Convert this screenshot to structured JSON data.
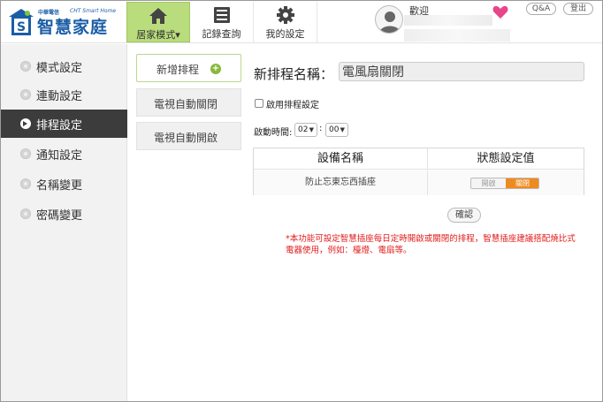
{
  "app": {
    "logo_title": "智慧家庭",
    "logo_company": "中華電信",
    "logo_english": "CHT Smart Home"
  },
  "topnav": {
    "items": [
      {
        "label": "居家模式▾",
        "icon": "home-icon",
        "active": true
      },
      {
        "label": "記錄查詢",
        "icon": "list-icon",
        "active": false
      },
      {
        "label": "我的設定",
        "icon": "gear-icon",
        "active": false
      }
    ]
  },
  "user": {
    "welcome": "歡迎"
  },
  "header_buttons": {
    "qa": "Q&A",
    "logout": "登出"
  },
  "sidebar": {
    "items": [
      {
        "label": "模式設定",
        "active": false
      },
      {
        "label": "連動設定",
        "active": false
      },
      {
        "label": "排程設定",
        "active": true
      },
      {
        "label": "通知設定",
        "active": false
      },
      {
        "label": "名稱變更",
        "active": false
      },
      {
        "label": "密碼變更",
        "active": false
      }
    ]
  },
  "schedules": {
    "new_label": "新增排程",
    "new_icon": "+",
    "items": [
      {
        "label": "電視自動關閉"
      },
      {
        "label": "電視自動開啟"
      }
    ]
  },
  "form": {
    "name_label": "新排程名稱：",
    "name_value": "電風扇關閉",
    "enable_label": "啟用排程設定",
    "enable_checked": false,
    "start_time_label": "啟動時間:",
    "hour": "02",
    "minute": "00",
    "colon": ":"
  },
  "device_table": {
    "col_device": "設備名稱",
    "col_state": "狀態設定值",
    "rows": [
      {
        "device": "防止忘東忘西插座",
        "off_label": "開啟",
        "on_label": "關閉",
        "selected": "關閉"
      }
    ]
  },
  "confirm_label": "確認",
  "note": "*本功能可設定智慧插座每日定時開啟或關閉的排程，智慧插座建議搭配燒比式電器使用，例如：檯燈、電扇等。",
  "colors": {
    "nav_active": "#b9dc7d",
    "sidebar_active": "#3c3c3c",
    "toggle_on": "#ef8a1e",
    "note_red": "#e21b1b",
    "brand_blue": "#1a5da6",
    "heart": "#e8458b"
  }
}
